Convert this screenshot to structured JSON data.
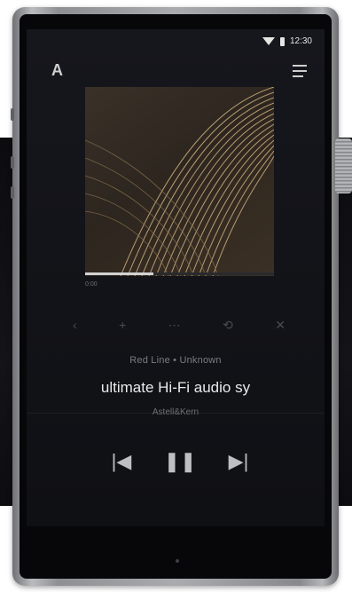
{
  "status_bar": {
    "time": "12:30",
    "wifi_icon": "wifi-icon",
    "battery_icon": "battery-icon"
  },
  "header": {
    "logo_text": "A",
    "menu_icon": "menu-icon"
  },
  "player": {
    "progress_fraction": 0.36,
    "elapsed_time": "0:00",
    "secondary_controls": [
      "back-icon",
      "add-icon",
      "more-icon",
      "repeat-icon",
      "shuffle-icon"
    ],
    "artist": "Red Line • Unknown",
    "title": "ultimate Hi-Fi audio sy",
    "album": "Astell&Kern",
    "transport": {
      "prev_symbol": "|◀",
      "pause_symbol": "❚❚",
      "next_symbol": "▶|"
    }
  },
  "colors": {
    "screen_bg": "#121318",
    "album_art_gold": "#c8a97a",
    "text_primary": "#eaeaea",
    "text_muted": "#7b7c82"
  }
}
